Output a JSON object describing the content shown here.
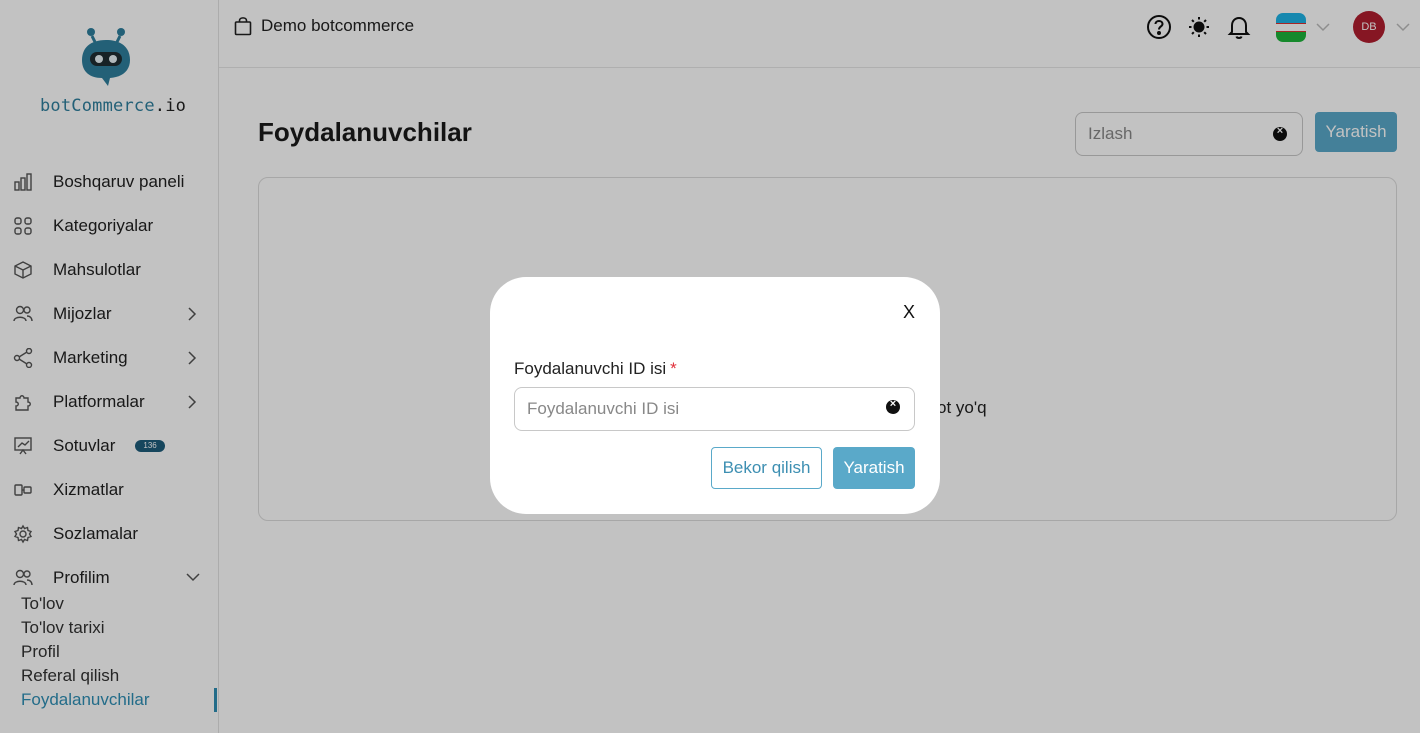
{
  "brand": {
    "name_main": "botCommerce",
    "name_suffix": ".io",
    "logo_icon": "robot-logo-icon"
  },
  "sidebar": {
    "items": [
      {
        "label": "Boshqaruv paneli",
        "icon": "bar-chart-icon",
        "has_submenu": false
      },
      {
        "label": "Kategoriyalar",
        "icon": "grid-icon",
        "has_submenu": false
      },
      {
        "label": "Mahsulotlar",
        "icon": "box-icon",
        "has_submenu": false
      },
      {
        "label": "Mijozlar",
        "icon": "users-icon",
        "has_submenu": true
      },
      {
        "label": "Marketing",
        "icon": "share-icon",
        "has_submenu": true
      },
      {
        "label": "Platformalar",
        "icon": "puzzle-icon",
        "has_submenu": true
      },
      {
        "label": "Sotuvlar",
        "icon": "sales-chart-icon",
        "badge": "136"
      },
      {
        "label": "Xizmatlar",
        "icon": "services-icon",
        "has_submenu": false
      },
      {
        "label": "Sozlamalar",
        "icon": "gear-icon",
        "has_submenu": false
      },
      {
        "label": "Profilim",
        "icon": "profile-icon",
        "expanded": true
      }
    ],
    "profile_submenu": [
      "To'lov",
      "To'lov tarixi",
      "Profil",
      "Referal qilish",
      "Foydalanuvchilar"
    ],
    "active_submenu": "Foydalanuvchilar"
  },
  "header": {
    "store_name": "Demo botcommerce",
    "store_icon": "shopping-bag-icon",
    "icons": [
      "help-icon",
      "sun-icon",
      "bell-icon"
    ],
    "language_flag": "uzbekistan-flag",
    "avatar_initials": "DB"
  },
  "main": {
    "title": "Foydalanuvchilar",
    "search_placeholder": "Izlash",
    "create_button": "Yaratish",
    "empty_text": "ot yo'q"
  },
  "modal": {
    "close_label": "X",
    "field_label": "Foydalanuvchi ID isi",
    "required_mark": "*",
    "input_placeholder": "Foydalanuvchi ID isi",
    "input_value": "",
    "cancel_button": "Bekor qilish",
    "submit_button": "Yaratish"
  },
  "colors": {
    "accent": "#5aa9c9",
    "active_link": "#2f8fb5",
    "badge_bg": "#1d5c7b",
    "avatar_bg": "#b01e2e",
    "required": "#e0303a"
  }
}
